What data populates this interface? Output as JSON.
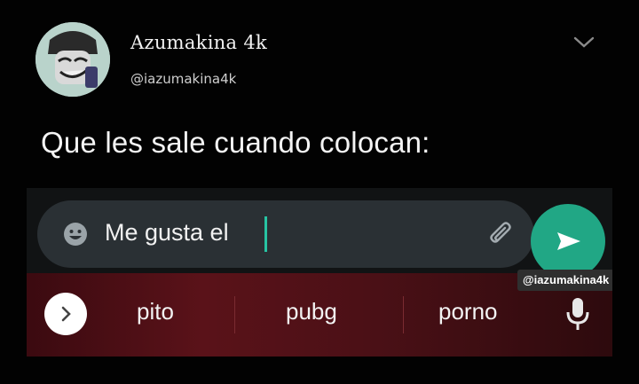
{
  "tweet": {
    "display_name": "Azumakina 4k",
    "handle": "@iazumakina4k",
    "text": "Que les sale cuando colocan:"
  },
  "compose": {
    "text": "Me gusta el"
  },
  "watermark": "@iazumakina4k",
  "suggestions": [
    "pito",
    "pubg",
    "porno"
  ],
  "colors": {
    "send": "#21a785",
    "caret": "#27c4a3",
    "suggest_bg": "#5a1219"
  },
  "icons": {
    "chevron": "chevron-down-icon",
    "emoji": "emoji-icon",
    "attach": "paperclip-icon",
    "send": "send-icon",
    "expand": "chevron-right-icon",
    "mic": "microphone-icon"
  }
}
